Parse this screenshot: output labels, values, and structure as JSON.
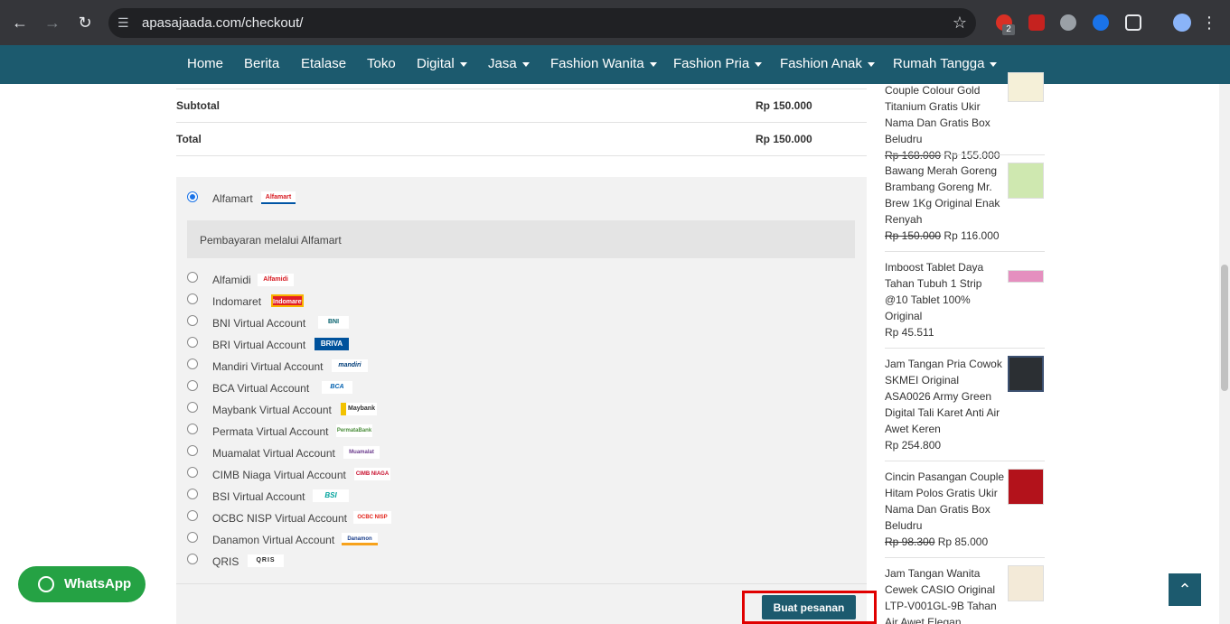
{
  "browser": {
    "url": "apasajaada.com/checkout/",
    "ext_badge": "2"
  },
  "nav": {
    "items": [
      {
        "label": "Home",
        "dropdown": false
      },
      {
        "label": "Berita",
        "dropdown": false
      },
      {
        "label": "Etalase",
        "dropdown": false
      },
      {
        "label": "Toko",
        "dropdown": false
      },
      {
        "label": "Digital",
        "dropdown": true
      },
      {
        "label": "Jasa",
        "dropdown": true
      },
      {
        "label": "Fashion Wanita",
        "dropdown": true
      },
      {
        "label": "Fashion Pria",
        "dropdown": true
      },
      {
        "label": "Fashion Anak",
        "dropdown": true
      },
      {
        "label": "Rumah Tangga",
        "dropdown": true
      }
    ]
  },
  "totals": {
    "subtotal_label": "Subtotal",
    "subtotal_value": "Rp 150.000",
    "total_label": "Total",
    "total_value": "Rp 150.000"
  },
  "payment": {
    "selected": "Alfamart",
    "selected_desc": "Pembayaran melalui Alfamart",
    "methods": [
      {
        "label": "Alfamart",
        "logo": "Alfamart"
      },
      {
        "label": "Alfamidi",
        "logo": "Alfamidi"
      },
      {
        "label": "Indomaret",
        "logo": "Indomaret"
      },
      {
        "label": "BNI Virtual Account",
        "logo": "BNI"
      },
      {
        "label": "BRI Virtual Account",
        "logo": "BRIVA"
      },
      {
        "label": "Mandiri Virtual Account",
        "logo": "mandiri"
      },
      {
        "label": "BCA Virtual Account",
        "logo": "BCA"
      },
      {
        "label": "Maybank Virtual Account",
        "logo": "Maybank"
      },
      {
        "label": "Permata Virtual Account",
        "logo": "PermataBank"
      },
      {
        "label": "Muamalat Virtual Account",
        "logo": "Muamalat"
      },
      {
        "label": "CIMB Niaga Virtual Account",
        "logo": "CIMB NIAGA"
      },
      {
        "label": "BSI Virtual Account",
        "logo": "BSI"
      },
      {
        "label": "OCBC NISP Virtual Account",
        "logo": "OCBC NISP"
      },
      {
        "label": "Danamon Virtual Account",
        "logo": "Danamon"
      },
      {
        "label": "QRIS",
        "logo": "QRIS"
      }
    ],
    "submit_label": "Buat pesanan"
  },
  "sidebar": {
    "products": [
      {
        "name": "Couple Colour Gold Titanium Gratis Ukir Nama Dan Gratis Box Beludru",
        "old_price": "Rp 168.000",
        "price": "Rp 155.000"
      },
      {
        "name": "Bawang Merah Goreng Brambang Goreng Mr. Brew 1Kg Original Enak Renyah",
        "old_price": "Rp 150.000",
        "price": "Rp 116.000"
      },
      {
        "name": "Imboost Tablet Daya Tahan Tubuh 1 Strip @10 Tablet 100% Original",
        "old_price": "",
        "price": "Rp 45.511"
      },
      {
        "name": "Jam Tangan Pria Cowok SKMEI Original ASA0026 Army Green Digital Tali Karet Anti Air Awet Keren",
        "old_price": "",
        "price": "Rp 254.800"
      },
      {
        "name": "Cincin Pasangan Couple Hitam Polos Gratis Ukir Nama Dan Gratis Box Beludru",
        "old_price": "Rp 98.300",
        "price": "Rp 85.000"
      },
      {
        "name": "Jam Tangan Wanita Cewek CASIO Original LTP-V001GL-9B Tahan Air Awet Elegan",
        "old_price": "",
        "price": ""
      }
    ]
  },
  "whatsapp": {
    "label": "WhatsApp"
  },
  "colors": {
    "brand": "#1c5a6e",
    "whatsapp": "#25a244",
    "highlight": "#e00000"
  }
}
